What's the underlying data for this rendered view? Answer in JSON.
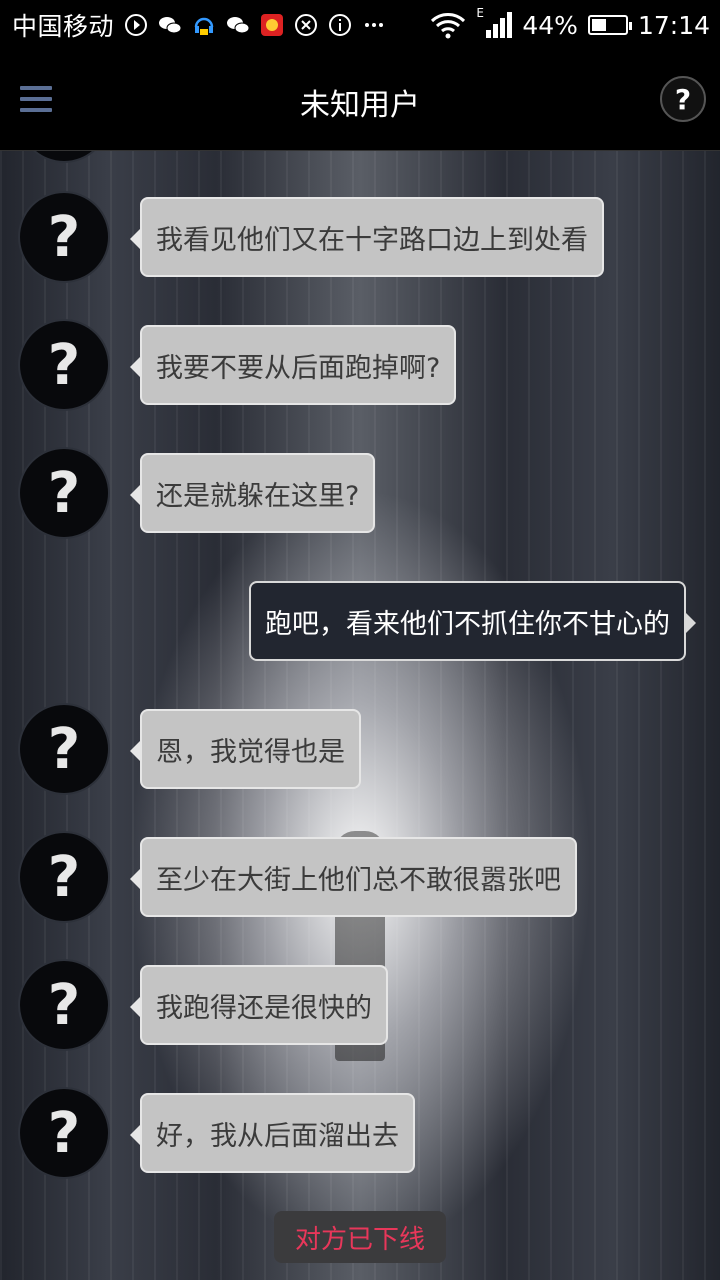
{
  "status_bar": {
    "carrier": "中国移动",
    "network": "E",
    "battery": "44%",
    "battery_level": 0.44,
    "time": "17:14",
    "icons": [
      "play-icon",
      "wechat-icon",
      "headset-icon",
      "wechat-icon",
      "app-icon",
      "sync-icon",
      "info-icon",
      "more-icon",
      "wifi-icon",
      "signal-icon",
      "battery-icon"
    ]
  },
  "header": {
    "title": "未知用户",
    "help_label": "?"
  },
  "avatar_glyph": "?",
  "messages": [
    {
      "from": "other",
      "text": "我看见他们又在十字路口边上到处看"
    },
    {
      "from": "other",
      "text": "我要不要从后面跑掉啊?"
    },
    {
      "from": "other",
      "text": "还是就躲在这里?"
    },
    {
      "from": "me",
      "text": "跑吧，看来他们不抓住你不甘心的"
    },
    {
      "from": "other",
      "text": "恩，我觉得也是"
    },
    {
      "from": "other",
      "text": "至少在大街上他们总不敢很嚣张吧"
    },
    {
      "from": "other",
      "text": "我跑得还是很快的"
    },
    {
      "from": "other",
      "text": "好，我从后面溜出去"
    }
  ],
  "notice": "对方已下线",
  "colors": {
    "notice": "#e8375a",
    "menu_icon": "#5b6f95"
  }
}
